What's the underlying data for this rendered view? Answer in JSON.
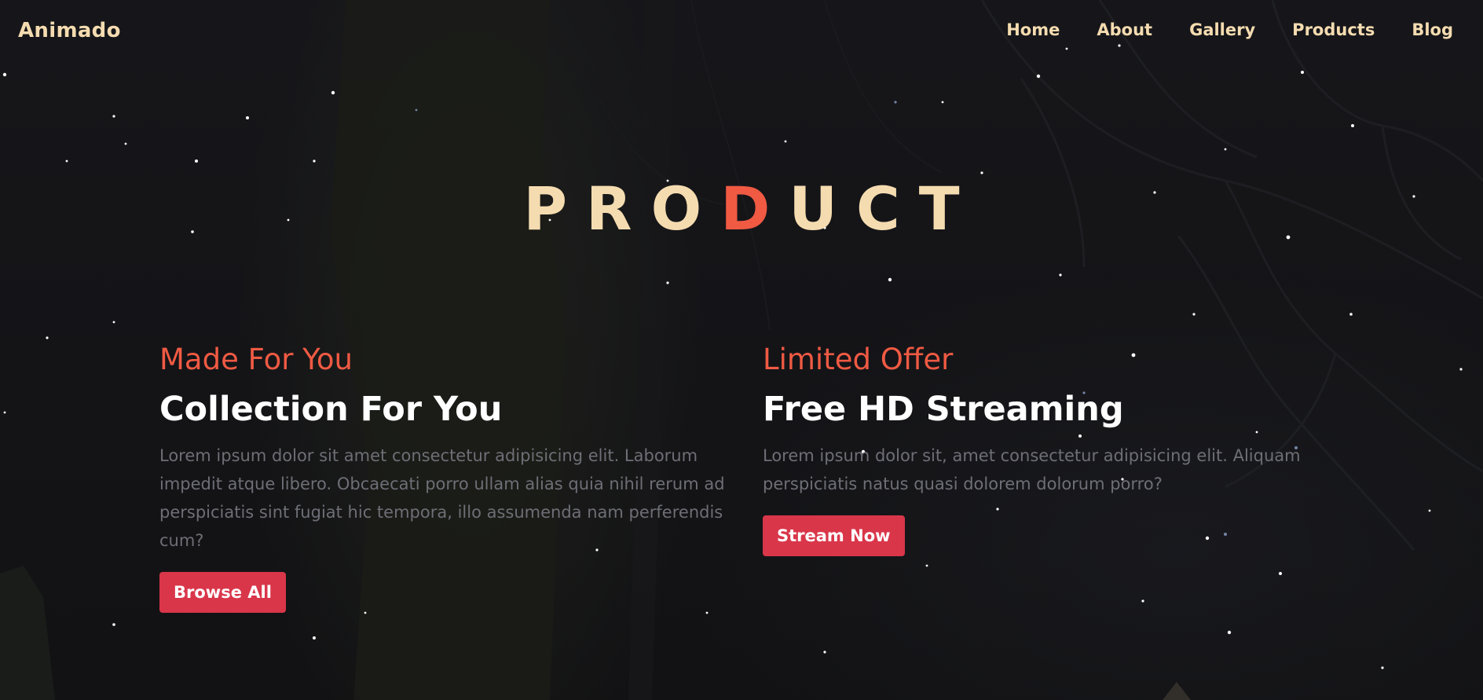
{
  "brand": {
    "logo": "Animado"
  },
  "nav": [
    {
      "label": "Home"
    },
    {
      "label": "About"
    },
    {
      "label": "Gallery"
    },
    {
      "label": "Products"
    },
    {
      "label": "Blog"
    }
  ],
  "hero": {
    "heading_before": "PRO",
    "heading_accent": "D",
    "heading_after": "UCT"
  },
  "cards": [
    {
      "eyebrow": "Made For You",
      "title": "Collection For You",
      "description": "Lorem ipsum dolor sit amet consectetur adipisicing elit. Laborum impedit atque libero. Obcaecati porro ullam alias quia nihil rerum ad perspiciatis sint fugiat hic tempora, illo assumenda nam perferendis cum?",
      "button": "Browse All"
    },
    {
      "eyebrow": "Limited Offer",
      "title": "Free HD Streaming",
      "description": "Lorem ipsum dolor sit, amet consectetur adipisicing elit. Aliquam perspiciatis natus quasi dolorem dolorum porro?",
      "button": "Stream Now"
    }
  ],
  "colors": {
    "accent": "#f05a43",
    "cream": "#f5dcb0",
    "button": "#d9364a",
    "background": "#141417",
    "muted_text": "#6e6e76"
  }
}
